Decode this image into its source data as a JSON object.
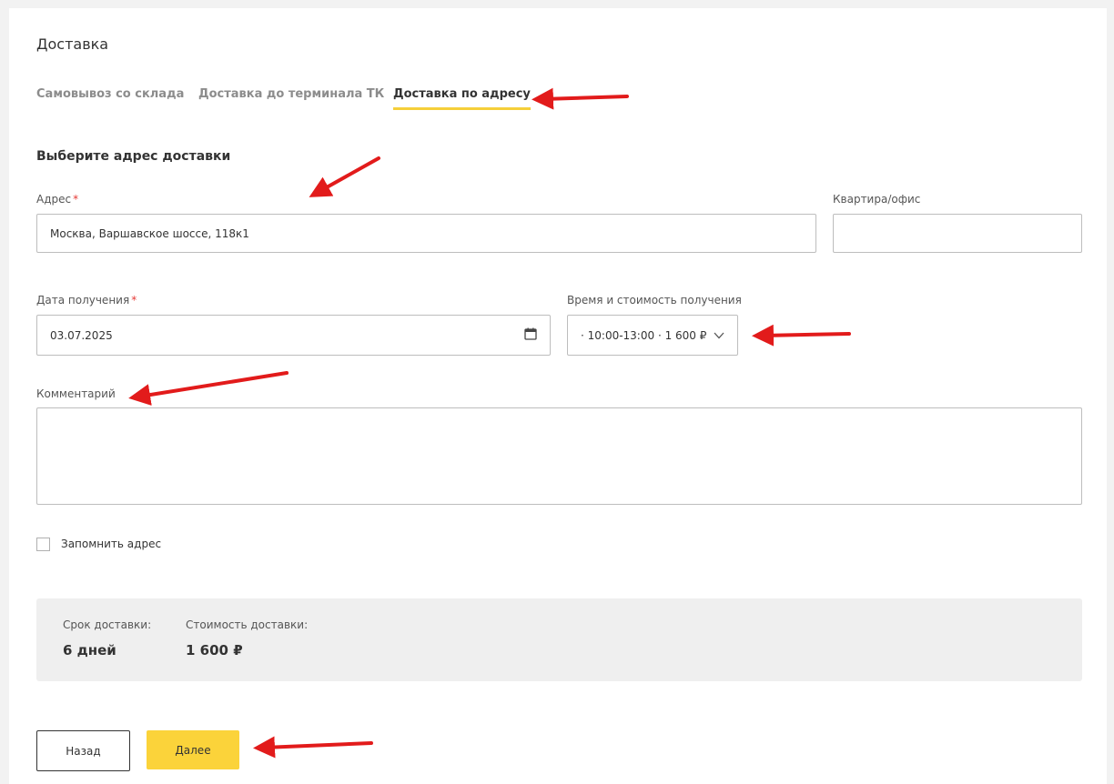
{
  "page": {
    "title": "Доставка"
  },
  "tabs": [
    {
      "label": "Самовывоз со склада",
      "active": false
    },
    {
      "label": "Доставка до терминала ТК",
      "active": false
    },
    {
      "label": "Доставка по адресу",
      "active": true
    }
  ],
  "section_title": "Выберите адрес доставки",
  "form": {
    "address": {
      "label": "Адрес",
      "required_mark": "*",
      "value": "Москва, Варшавское шоссе, 118к1"
    },
    "apartment": {
      "label": "Квартира/офис",
      "value": ""
    },
    "date": {
      "label": "Дата получения",
      "required_mark": "*",
      "value": "03.07.2025"
    },
    "time_cost": {
      "label": "Время и стоимость получения",
      "selected": "· 10:00-13:00 · 1 600 ₽"
    },
    "comment": {
      "label": "Комментарий",
      "value": ""
    },
    "remember": {
      "label": "Запомнить адрес",
      "checked": false
    }
  },
  "summary": {
    "term_label": "Срок доставки:",
    "term_value": "6 дней",
    "cost_label": "Стоимость доставки:",
    "cost_value": "1 600 ₽"
  },
  "buttons": {
    "back": "Назад",
    "next": "Далее"
  },
  "colors": {
    "accent": "#fbd33a",
    "tab_underline": "#f5cf3a",
    "required": "#e53935",
    "annotation_arrow": "#e21b1b"
  },
  "icons": {
    "date": "calendar-icon",
    "select": "chevron-down-icon",
    "annotations": "red-arrow-icon"
  }
}
